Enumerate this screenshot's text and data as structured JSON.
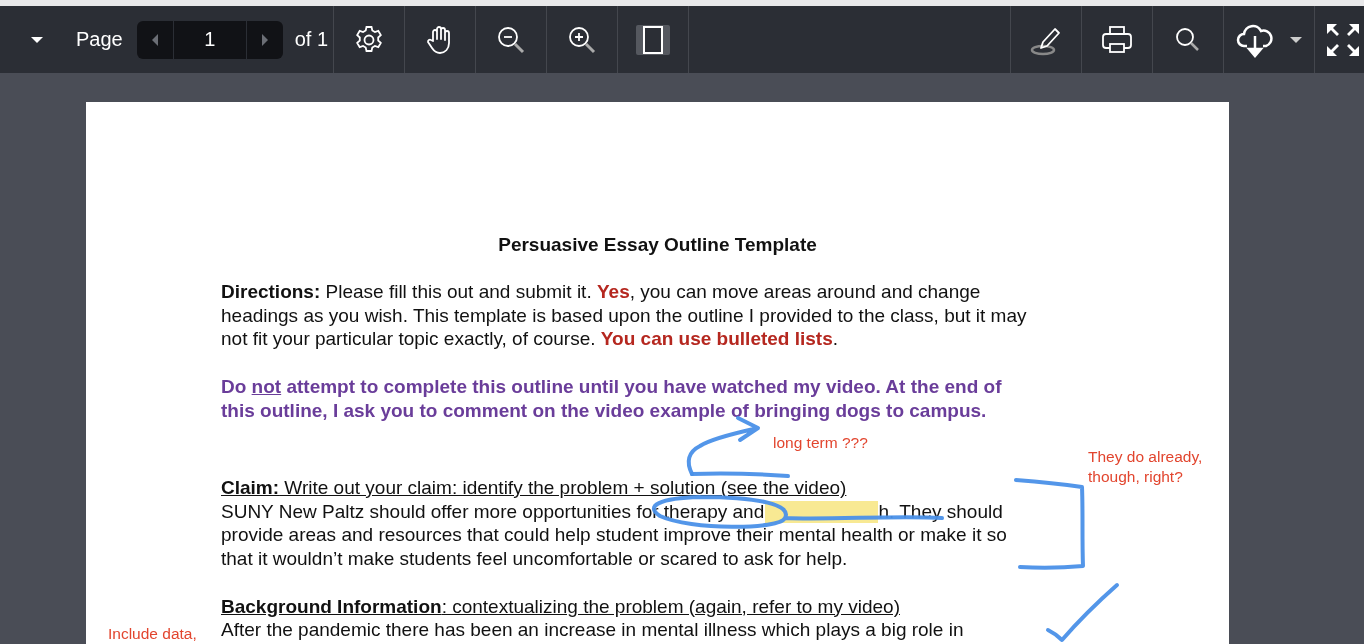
{
  "toolbar": {
    "page_label": "Page",
    "page_value": "1",
    "page_total": "of 1"
  },
  "document": {
    "title": "Persuasive Essay Outline Template",
    "paragraphs": [
      {
        "kind": "body",
        "lines": [
          [
            {
              "text": "Directions:",
              "bold": true
            },
            {
              "text": " Please fill this out and submit it. "
            },
            {
              "text": "Yes",
              "bold": true,
              "color": "#b5271f"
            },
            {
              "text": ", you can move areas around and change"
            }
          ],
          [
            {
              "text": "headings as you wish. This template is based upon the outline I provided to the class, but it may"
            }
          ],
          [
            {
              "text": "not fit your particular topic exactly, of course. "
            },
            {
              "text": "You can use bulleted lists",
              "bold": true,
              "color": "#b5271f"
            },
            {
              "text": "."
            }
          ]
        ]
      },
      {
        "kind": "body",
        "lines": [
          [
            {
              "text": "Do ",
              "bold": true,
              "color": "#6a3d9a"
            },
            {
              "text": "not",
              "bold": true,
              "underline": true,
              "color": "#6a3d9a"
            },
            {
              "text": " attempt to complete this outline until you have watched my video. At the end of",
              "bold": true,
              "color": "#6a3d9a"
            }
          ],
          [
            {
              "text": "this outline, I ask you to comment on the video example of bringing dogs to campus.",
              "bold": true,
              "color": "#6a3d9a"
            }
          ]
        ]
      },
      {
        "kind": "section",
        "lines": [
          [
            {
              "text": "Claim:",
              "bold": true,
              "underline": true
            },
            {
              "text": " Write out your claim: identify the problem + solution (see the video)",
              "underline": true
            }
          ],
          [
            {
              "text": "SUNY New Paltz should offer more opportunities for therapy and "
            },
            {
              "kind": "highlight"
            },
            {
              "text": "h. They should"
            }
          ],
          [
            {
              "text": "provide areas and resources that could help student improve their mental health or make it so"
            }
          ],
          [
            {
              "text": "that it wouldn’t make students feel uncomfortable or scared to ask for help."
            }
          ]
        ]
      },
      {
        "kind": "section",
        "lines": [
          [
            {
              "text": "Background Information",
              "bold": true,
              "underline": true
            },
            {
              "text": ": contextualizing the problem (again, refer to my video)",
              "underline": true
            }
          ],
          [
            {
              "text": "After the pandemic there has been an increase in mental illness which plays a big role in"
            }
          ]
        ]
      }
    ]
  },
  "comments": [
    {
      "kind": "long-term",
      "lines": [
        "long term ???"
      ]
    },
    {
      "kind": "already",
      "lines": [
        "They do already,",
        "though, right?"
      ]
    },
    {
      "kind": "data",
      "lines": [
        "Include data,"
      ]
    }
  ]
}
